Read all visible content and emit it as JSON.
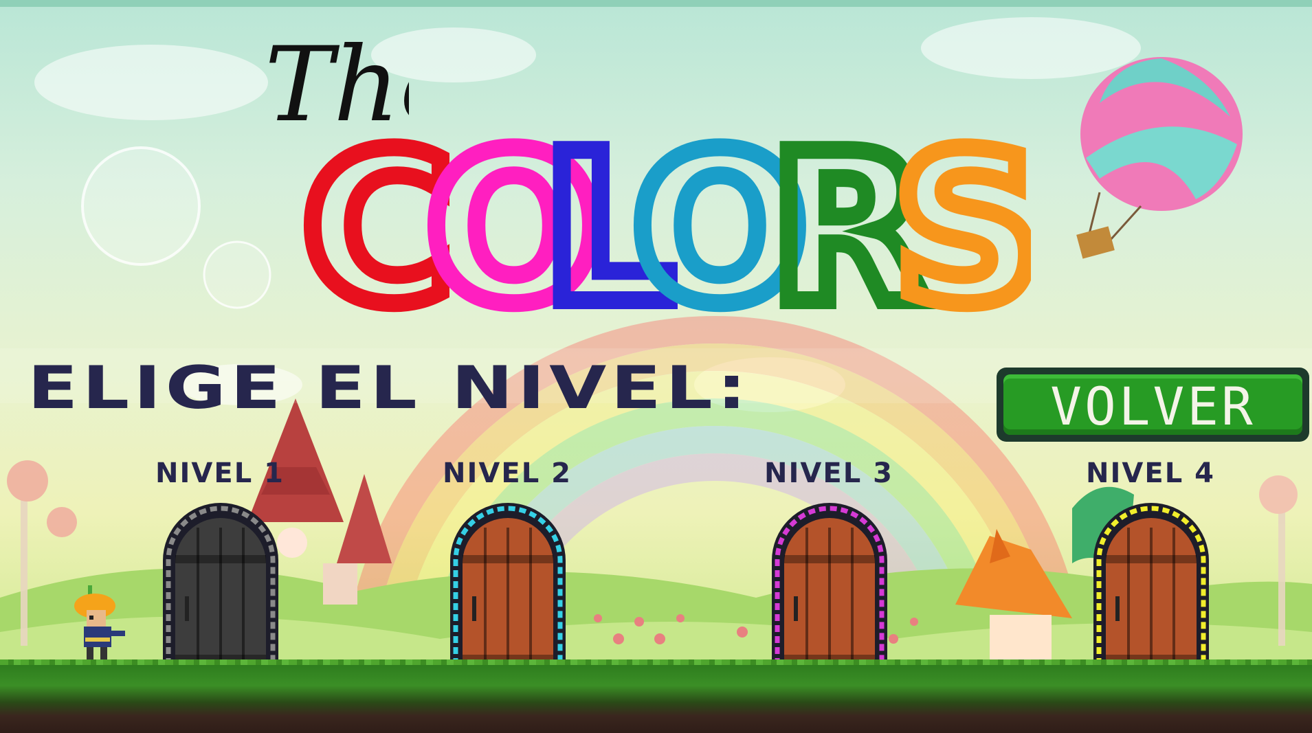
{
  "title": {
    "the": "The",
    "colors_letters": [
      {
        "char": "C",
        "color": "#e8101e"
      },
      {
        "char": "O",
        "color": "#ff1fc0"
      },
      {
        "char": "L",
        "color": "#2a23d8"
      },
      {
        "char": "O",
        "color": "#1a9ec9"
      },
      {
        "char": "R",
        "color": "#1f8a24"
      },
      {
        "char": "S",
        "color": "#f7961c"
      }
    ]
  },
  "heading": "ELIGE EL NIVEL:",
  "back_button": {
    "label": "VOLVER"
  },
  "levels": [
    {
      "label": "NIVEL 1",
      "frame_color": "#8a8a8a",
      "door_color": "#3d3d3d"
    },
    {
      "label": "NIVEL 2",
      "frame_color": "#35d0e6",
      "door_color": "#b4532a"
    },
    {
      "label": "NIVEL 3",
      "frame_color": "#d53ad5",
      "door_color": "#b4532a"
    },
    {
      "label": "NIVEL 4",
      "frame_color": "#f2ee2c",
      "door_color": "#b4532a"
    }
  ],
  "icons": [
    "player-character-icon",
    "hot-air-balloon-icon",
    "rainbow-icon",
    "bubble-icon",
    "mushroom-house-icon"
  ]
}
